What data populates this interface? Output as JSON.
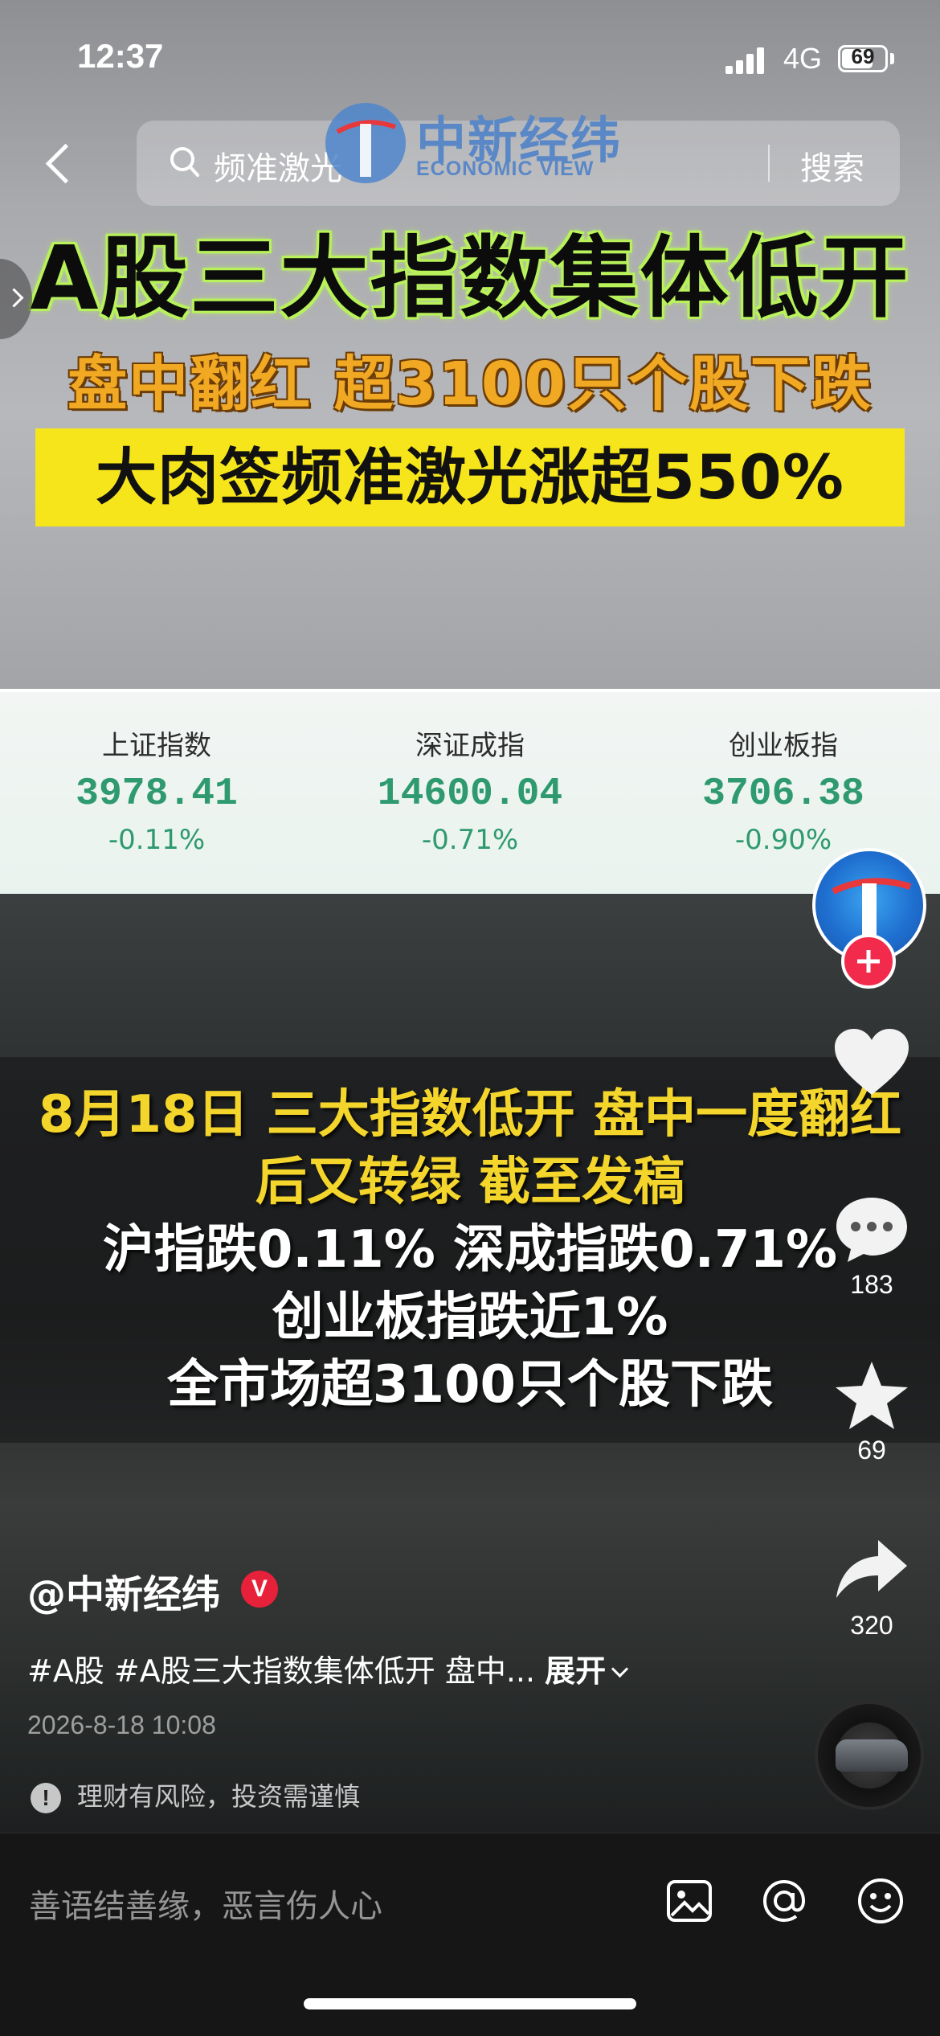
{
  "status_bar": {
    "time": "12:37",
    "network": "4G",
    "battery": "69"
  },
  "search": {
    "query": "频准激光",
    "button_label": "搜索"
  },
  "logo": {
    "cn": "中新经纬",
    "en": "ECONOMIC VIEW"
  },
  "headlines": {
    "line1": "A股三大指数集体低开",
    "line2": "盘中翻红 超3100只个股下跌",
    "line3": "大肉签频准激光涨超550%"
  },
  "indices": [
    {
      "name": "上证指数",
      "value": "3978.41",
      "change": "-0.11%"
    },
    {
      "name": "深证成指",
      "value": "14600.04",
      "change": "-0.71%"
    },
    {
      "name": "创业板指",
      "value": "3706.38",
      "change": "-0.90%"
    }
  ],
  "caption": [
    "8月18日 三大指数低开 盘中一度翻红",
    "后又转绿 截至发稿",
    "沪指跌0.11% 深成指跌0.71%",
    "创业板指跌近1%",
    "全市场超3100只个股下跌"
  ],
  "rail": {
    "like_count": "",
    "comment_count": "183",
    "favorite_count": "69",
    "share_count": "320"
  },
  "post": {
    "author": "@中新经纬",
    "verified": "V",
    "description": "#A股 #A股三大指数集体低开 盘中...",
    "expand_label": "展开",
    "timestamp": "2026-8-18 10:08",
    "risk_notice": "理财有风险，投资需谨慎",
    "warning_glyph": "!"
  },
  "comment_bar": {
    "placeholder": "善语结善缘，恶言伤人心"
  },
  "colors": {
    "index_green": "#2f9a70",
    "headline_green_glow": "#b9f25c",
    "headline_orange": "#f1a923",
    "headline_yellow_bg": "#f6e51b",
    "caption_yellow": "#f4d52b",
    "follow_red": "#f22b4d"
  }
}
